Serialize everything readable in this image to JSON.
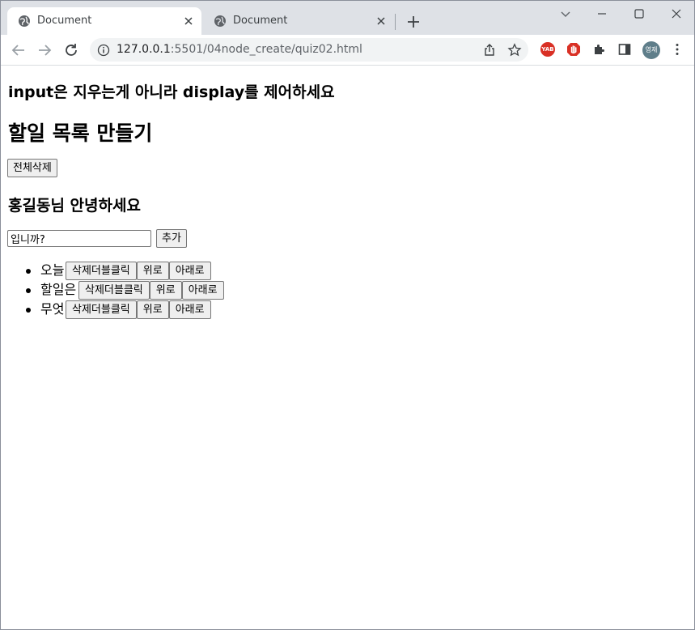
{
  "browser": {
    "tabs": [
      {
        "title": "Document",
        "active": true
      },
      {
        "title": "Document",
        "active": false
      }
    ],
    "url_host": "127.0.0.1",
    "url_path": ":5501/04node_create/quiz02.html",
    "profile_label": "영재",
    "extension_badge": "YAB",
    "colors": {
      "tab_strip": "#dee1e6",
      "omnibox": "#f1f3f4",
      "ext_red": "#d93025",
      "profile": "#5f7e8a"
    }
  },
  "page": {
    "notice": "input은 지우는게 아니라 display를 제어하세요",
    "title": "할일 목록 만들기",
    "delete_all_label": "전체삭제",
    "greeting": "홍길동님 안녕하세요",
    "input_value": "입니까?",
    "add_label": "추가",
    "items": [
      {
        "text": "오늘",
        "delete_label": "삭제더블클릭",
        "up_label": "위로",
        "down_label": "아래로"
      },
      {
        "text": "할일은",
        "delete_label": "삭제더블클릭",
        "up_label": "위로",
        "down_label": "아래로"
      },
      {
        "text": "무엇",
        "delete_label": "삭제더블클릭",
        "up_label": "위로",
        "down_label": "아래로"
      }
    ]
  }
}
